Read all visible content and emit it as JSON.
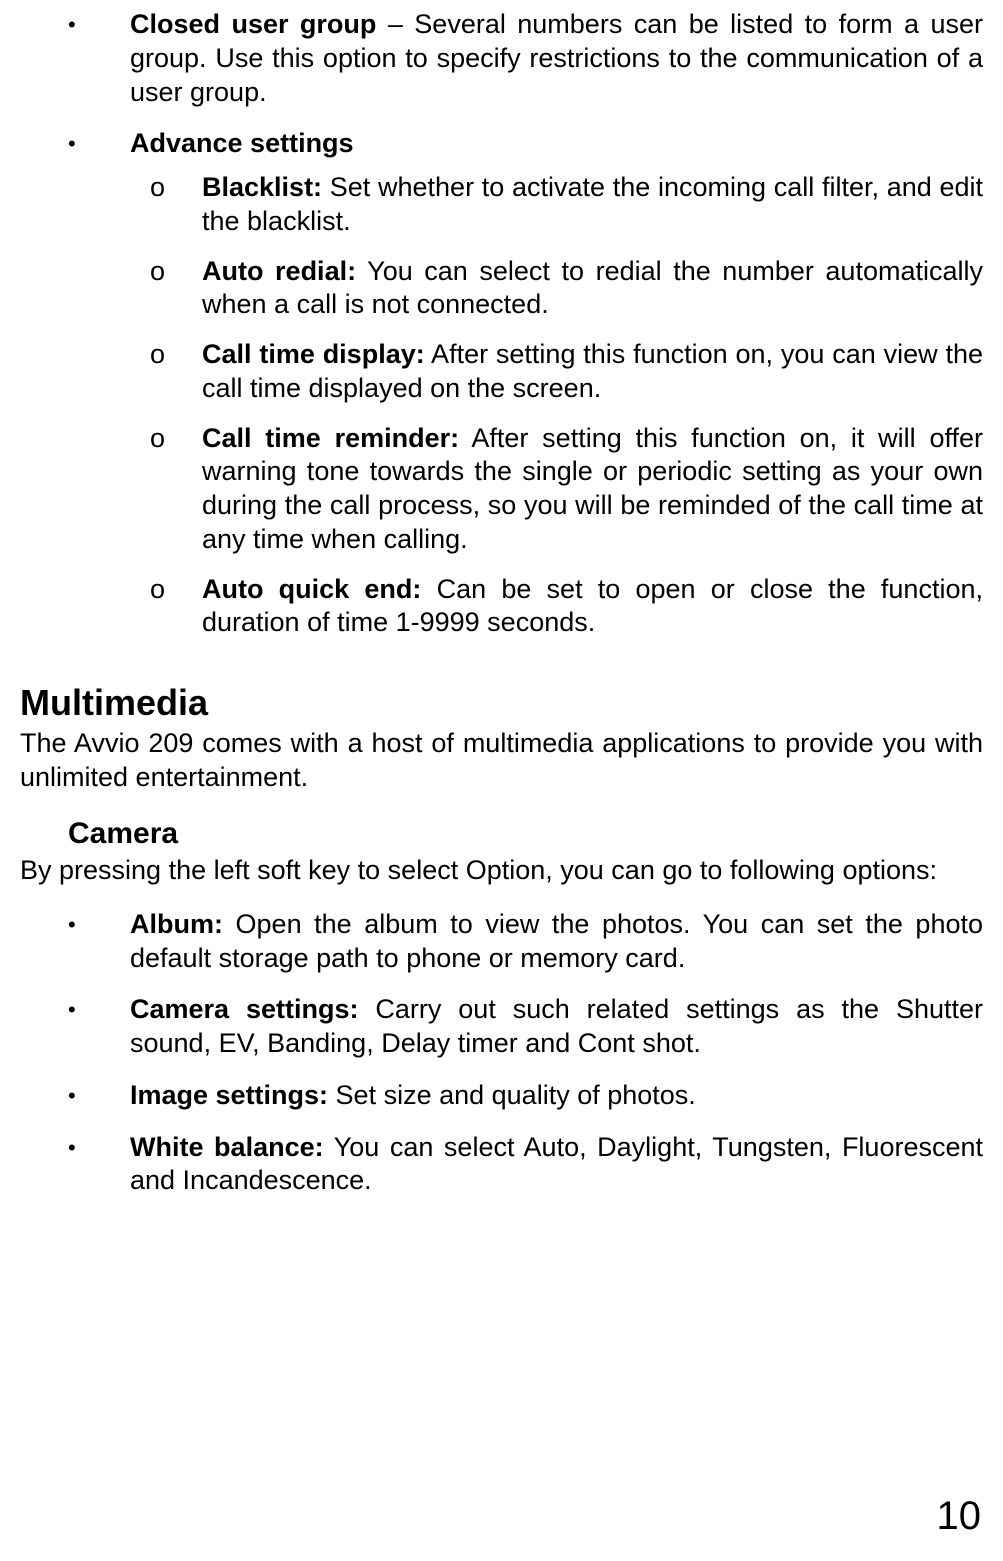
{
  "bullets": {
    "closedUserGroup": {
      "title": "Closed user group",
      "text": " – Several numbers can be listed to form a user group. Use this option to specify restrictions to the communication of a user group."
    },
    "advanceSettings": {
      "title": "Advance settings",
      "sub": {
        "blacklist": {
          "title": "Blacklist:",
          "text": " Set whether to activate the incoming call filter, and edit the blacklist."
        },
        "autoRedial": {
          "title": "Auto redial:",
          "text": " You can select to redial the number automatically when a call is not connected."
        },
        "callTimeDisplay": {
          "title": "Call time display:",
          "text": " After setting this function on, you can view the call time displayed on the screen."
        },
        "callTimeReminder": {
          "title": "Call time reminder:",
          "text": " After setting this function on, it will offer warning tone towards the single or periodic setting as your own during the call process, so you will be reminded of the call time at any time when calling."
        },
        "autoQuickEnd": {
          "title": "Auto quick end:",
          "text": " Can be set to open or close the function, duration of time 1-9999 seconds."
        }
      }
    }
  },
  "multimedia": {
    "title": "Multimedia",
    "body": "The Avvio 209 comes with a host of multimedia applications to provide you with unlimited entertainment."
  },
  "camera": {
    "title": "Camera",
    "body": "By pressing the left soft key to select Option, you can go to following options:",
    "items": {
      "album": {
        "title": "Album:",
        "text": " Open the album to view the photos. You can set the photo default storage path to phone or memory card."
      },
      "cameraSettings": {
        "title": "Camera settings:",
        "text": " Carry out such related settings as the Shutter sound, EV, Banding, Delay timer and Cont shot."
      },
      "imageSettings": {
        "title": "Image settings:",
        "text": " Set size and quality of photos."
      },
      "whiteBalance": {
        "title": "White balance:",
        "text": " You can select Auto, Daylight, Tungsten, Fluorescent and Incandescence."
      }
    }
  },
  "pageNumber": "10",
  "markers": {
    "bullet": "•",
    "subBullet": "o"
  }
}
